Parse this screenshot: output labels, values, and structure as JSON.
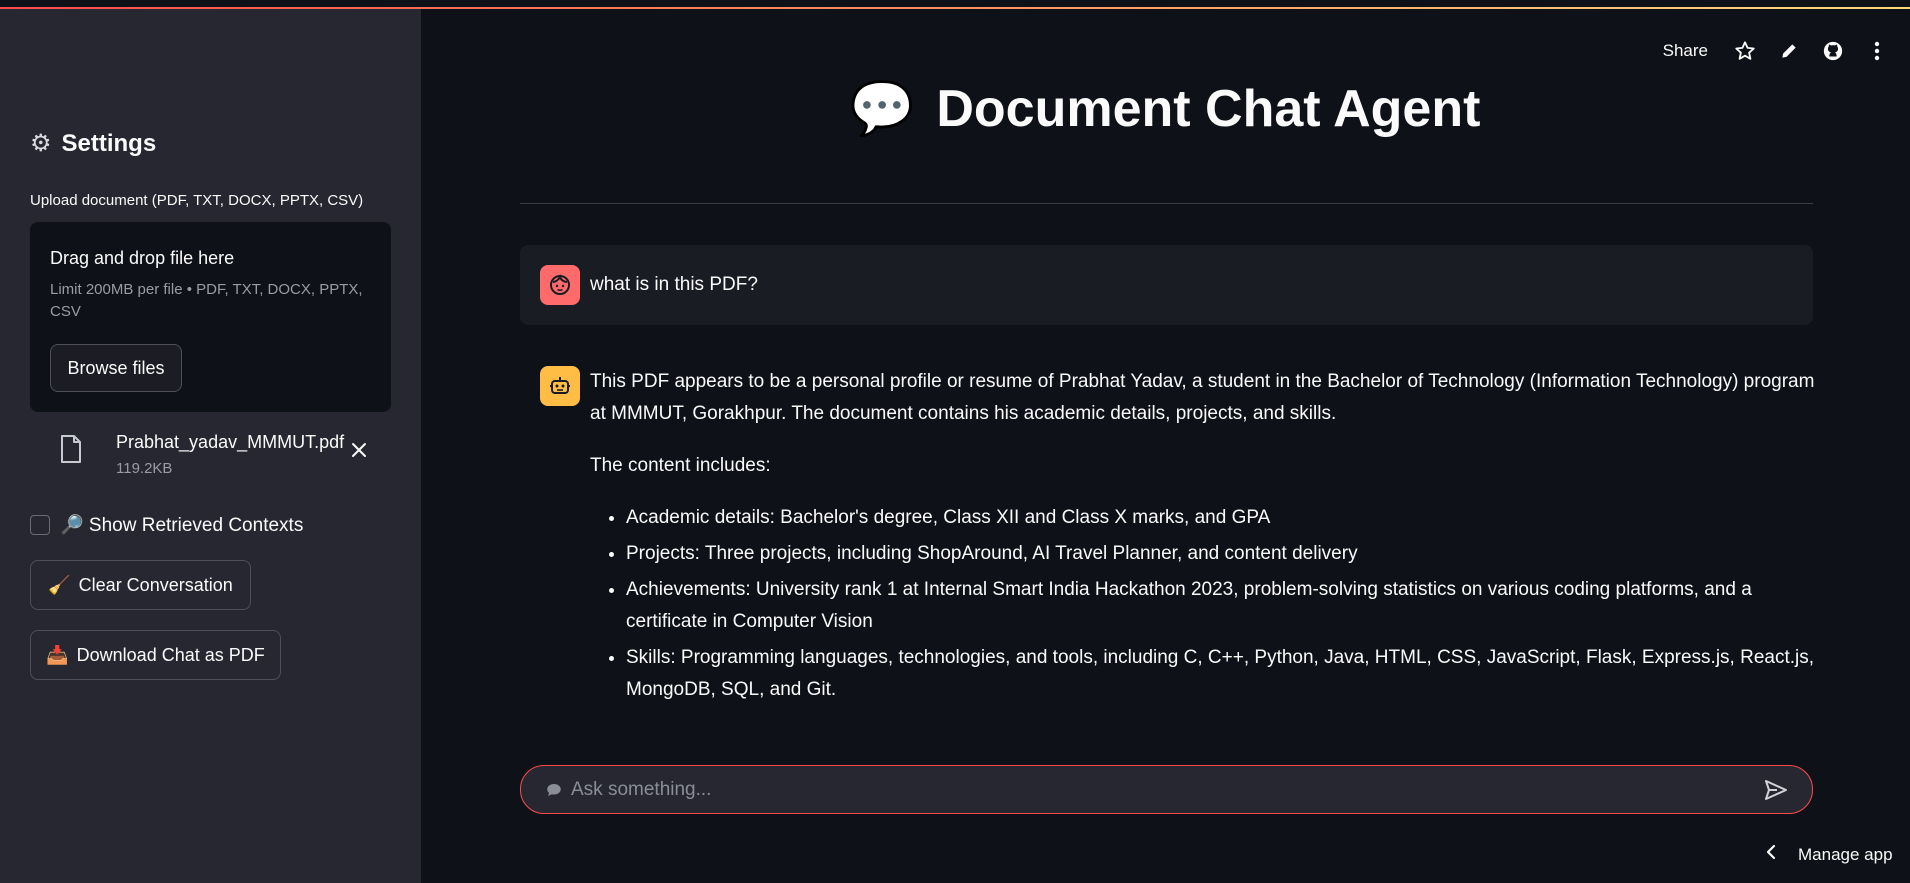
{
  "sidebar": {
    "settings_title": "Settings",
    "upload_label": "Upload document (PDF, TXT, DOCX, PPTX, CSV)",
    "dropzone": {
      "title": "Drag and drop file here",
      "limit": "Limit 200MB per file • PDF, TXT, DOCX, PPTX, CSV",
      "browse_label": "Browse files"
    },
    "file": {
      "name": "Prabhat_yadav_MMMUT.pdf",
      "size": "119.2KB"
    },
    "show_contexts_label": "🔎 Show Retrieved Contexts",
    "clear_label": "Clear Conversation",
    "clear_emoji": "🧹",
    "download_label": "Download Chat as PDF",
    "download_emoji": "📥"
  },
  "toolbar": {
    "share_label": "Share"
  },
  "main": {
    "title": "Document Chat Agent",
    "title_emoji": "💬",
    "messages": [
      {
        "role": "user",
        "text": "what is in this PDF?"
      },
      {
        "role": "assistant",
        "intro": "This PDF appears to be a personal profile or resume of Prabhat Yadav, a student in the Bachelor of Technology (Information Technology) program at MMMUT, Gorakhpur. The document contains his academic details, projects, and skills.",
        "lead": "The content includes:",
        "bullets": [
          "Academic details: Bachelor's degree, Class XII and Class X marks, and GPA",
          "Projects: Three projects, including ShopAround, AI Travel Planner, and content delivery",
          "Achievements: University rank 1 at Internal Smart India Hackathon 2023, problem-solving statistics on various coding platforms, and a certificate in Computer Vision",
          "Skills: Programming languages, technologies, and tools, including C, C++, Python, Java, HTML, CSS, JavaScript, Flask, Express.js, React.js, MongoDB, SQL, and Git."
        ]
      }
    ],
    "chat_placeholder": "Ask something..."
  },
  "footer": {
    "manage_app_label": "Manage app"
  },
  "colors": {
    "accent": "#ff4b4b",
    "sidebar_bg": "#262730",
    "main_bg": "#0e1117",
    "user_avatar": "#ff6b6b",
    "bot_avatar": "#ffbd45"
  }
}
